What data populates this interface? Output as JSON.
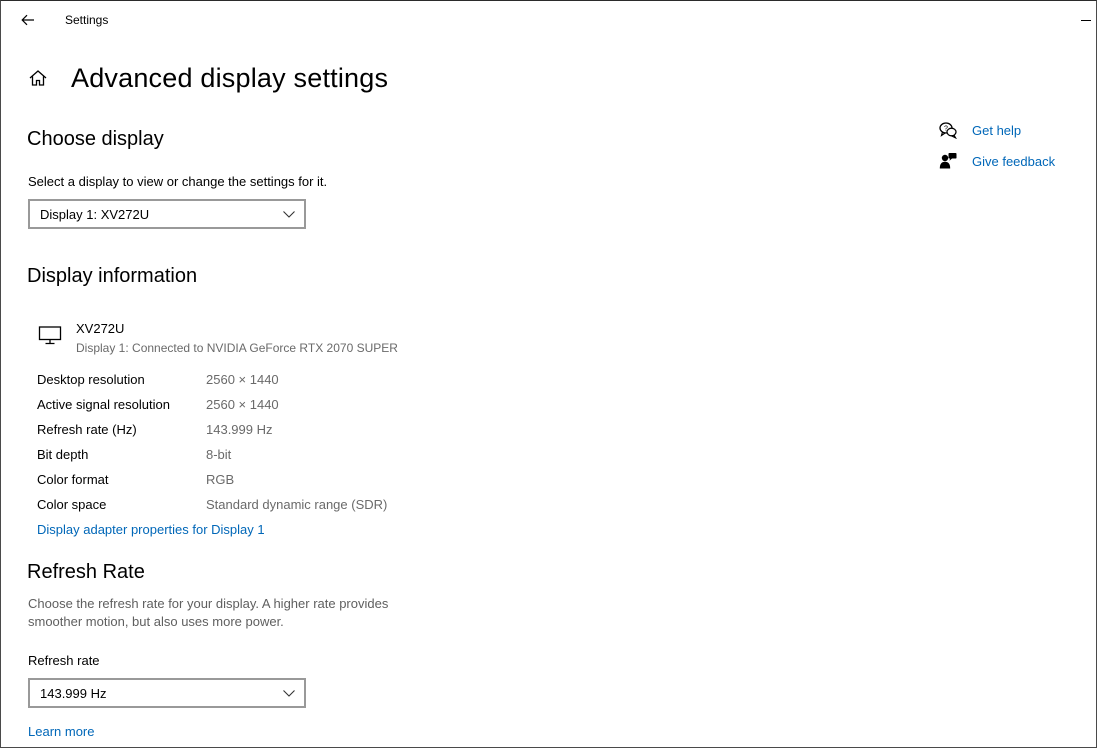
{
  "window": {
    "title": "Settings"
  },
  "page": {
    "title": "Advanced display settings"
  },
  "choose_display": {
    "heading": "Choose display",
    "description": "Select a display to view or change the settings for it.",
    "selected": "Display 1: XV272U"
  },
  "display_info": {
    "heading": "Display information",
    "monitor_name": "XV272U",
    "monitor_subtitle": "Display 1: Connected to NVIDIA GeForce RTX 2070 SUPER",
    "rows": [
      {
        "label": "Desktop resolution",
        "value": "2560 × 1440"
      },
      {
        "label": "Active signal resolution",
        "value": "2560 × 1440"
      },
      {
        "label": "Refresh rate (Hz)",
        "value": "143.999 Hz"
      },
      {
        "label": "Bit depth",
        "value": "8-bit"
      },
      {
        "label": "Color format",
        "value": "RGB"
      },
      {
        "label": "Color space",
        "value": "Standard dynamic range (SDR)"
      }
    ],
    "adapter_link": "Display adapter properties for Display 1"
  },
  "refresh_rate": {
    "heading": "Refresh Rate",
    "description_line1": "Choose the refresh rate for your display. A higher rate provides",
    "description_line2": "smoother motion, but also uses more power.",
    "field_label": "Refresh rate",
    "selected": "143.999 Hz",
    "learn_more": "Learn more"
  },
  "help": {
    "get_help": "Get help",
    "give_feedback": "Give feedback"
  },
  "colors": {
    "link": "#0067b8",
    "muted": "#6a6a6a"
  },
  "icons": [
    "back-arrow-icon",
    "minimize-icon",
    "home-icon",
    "chevron-down-icon",
    "monitor-icon",
    "help-chat-icon",
    "feedback-icon"
  ]
}
